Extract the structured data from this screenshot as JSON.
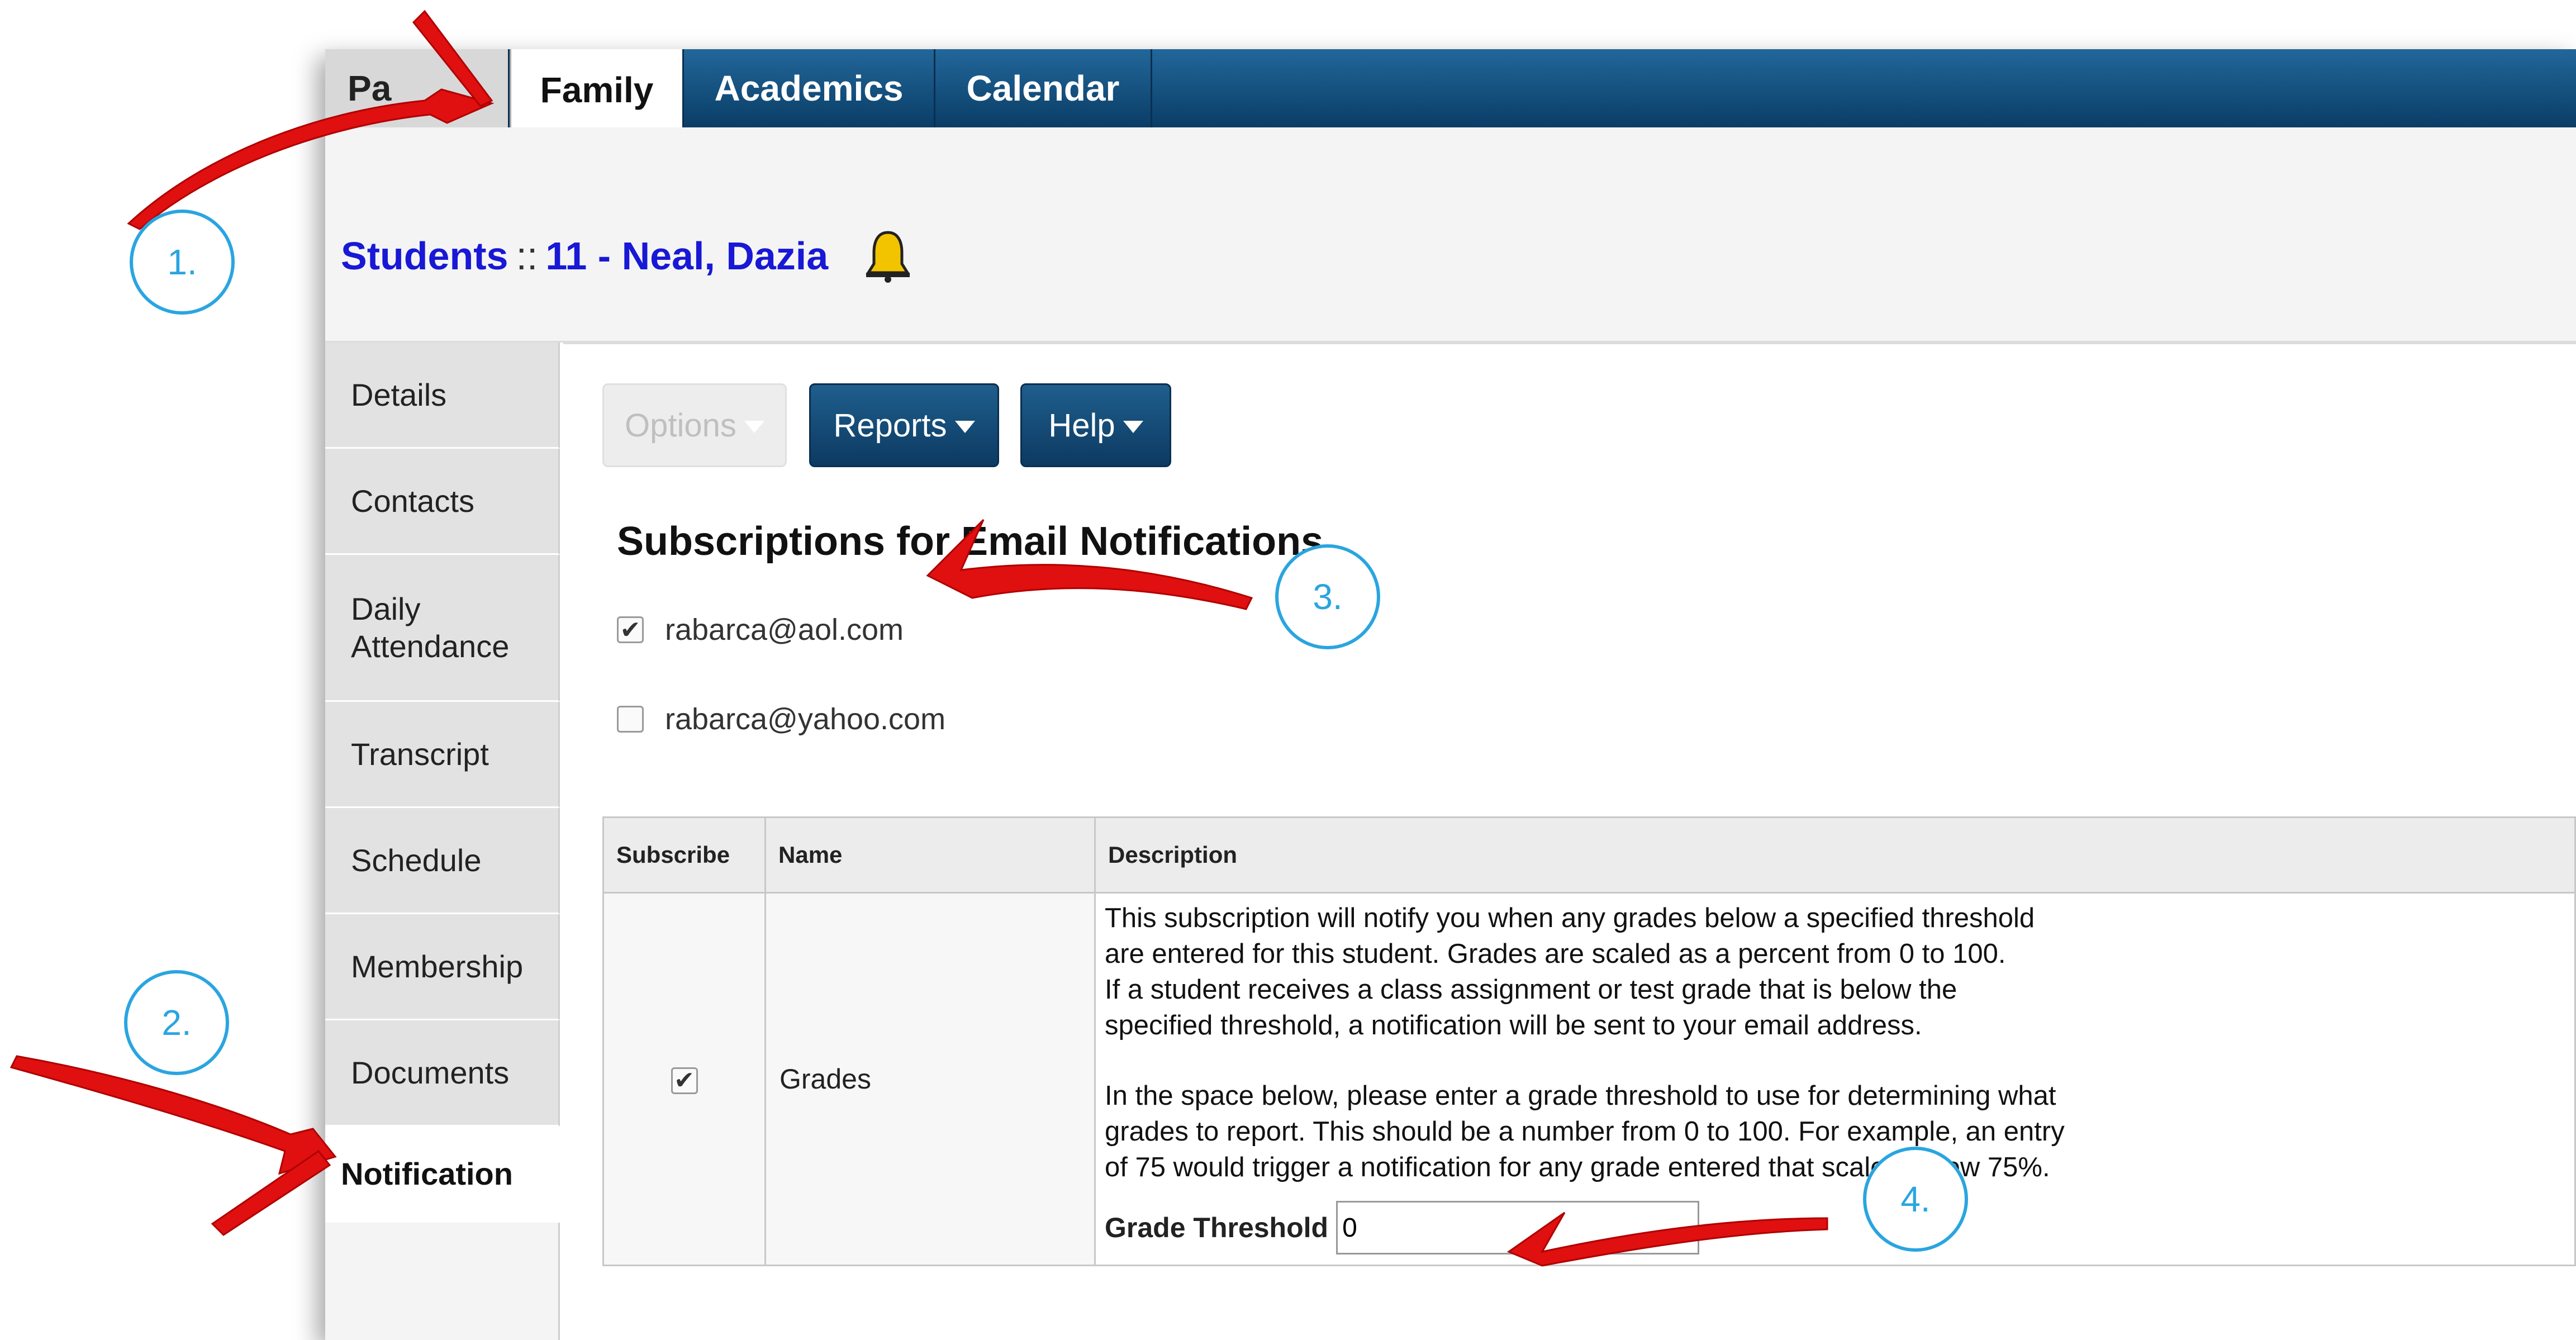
{
  "nav": {
    "tabs": [
      {
        "label": "Pa"
      },
      {
        "label": "Family"
      },
      {
        "label": "Academics"
      },
      {
        "label": "Calendar"
      }
    ]
  },
  "header": {
    "prefix": "Students",
    "separator": "::",
    "student": "11 - Neal, Dazia",
    "bell_icon": "bell-icon"
  },
  "sidebar": {
    "items": [
      {
        "label": "Details"
      },
      {
        "label": "Contacts"
      },
      {
        "label": "Daily Attendance"
      },
      {
        "label": "Transcript"
      },
      {
        "label": "Schedule"
      },
      {
        "label": "Membership"
      },
      {
        "label": "Documents"
      },
      {
        "label": "Notification"
      }
    ],
    "active_item": "Notification"
  },
  "toolbar": {
    "options_label": "Options",
    "reports_label": "Reports",
    "help_label": "Help"
  },
  "subscriptions": {
    "title": "Subscriptions for Email Notifications",
    "emails": [
      {
        "address": "rabarca@aol.com",
        "checked": true
      },
      {
        "address": "rabarca@yahoo.com",
        "checked": false
      }
    ]
  },
  "table": {
    "headers": [
      "Subscribe",
      "Name",
      "Description"
    ],
    "row": {
      "checked": true,
      "name": "Grades",
      "description_1": "This subscription will notify you when any grades below a specified threshold\nare entered for this student. Grades are scaled as a percent from 0 to 100.\nIf a student receives a class assignment or test grade that is below the\nspecified threshold, a notification will be sent to your email address.",
      "description_2": "In the space below, please enter a grade threshold to use for determining what\ngrades to report. This should be a number from 0 to 100. For example, an entry\nof 75 would trigger a notification for any grade entered that scaled below 75%.",
      "threshold_label": "Grade Threshold",
      "threshold_value": "0"
    }
  },
  "annotations": {
    "labels": [
      "1.",
      "2.",
      "3.",
      "4."
    ],
    "circle_color": "#2aa5e0",
    "arrow_color": "#e01010"
  }
}
